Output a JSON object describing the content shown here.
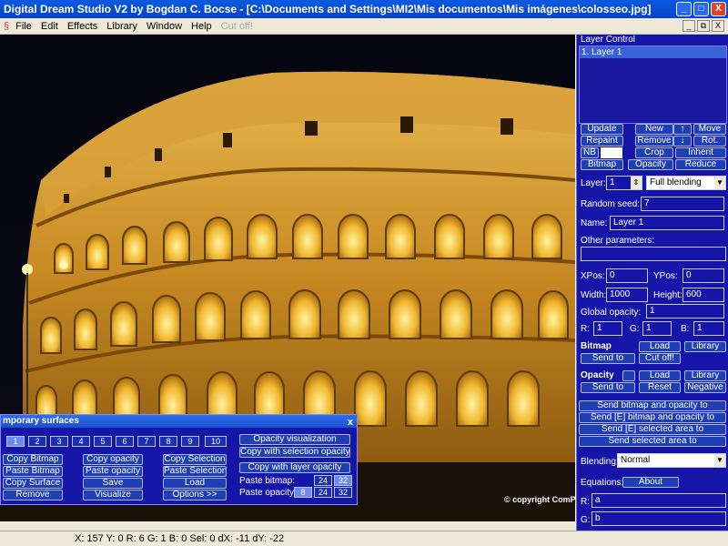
{
  "window": {
    "title": "Digital Dream Studio V2 by Bogdan C. Bocse - [C:\\Documents and Settings\\MI2\\Mis documentos\\Mis imágenes\\colosseo.jpg]",
    "buttons": [
      "_",
      "□",
      "X"
    ]
  },
  "menu": {
    "items": [
      "File",
      "Edit",
      "Effects",
      "Library",
      "Window",
      "Help"
    ],
    "disabled_item": "Cut off!"
  },
  "mdi_buttons": [
    "_",
    "⧉",
    "X"
  ],
  "canvas": {
    "copyright": "© copyright ComP"
  },
  "layer_control": {
    "title": "Layer Control",
    "layers": [
      "1. Layer 1"
    ],
    "buttons": {
      "update": "Update",
      "new": "New",
      "up": "↑",
      "move": "Move",
      "repaint": "Repaint",
      "remove": "Remove",
      "down": "↓",
      "rot": "Rot.",
      "nb": "NB",
      "crop": "Crop",
      "inherit": "Inherit",
      "bitmap": "Bitmap",
      "opacity": "Opacity",
      "reduce": "Reduce"
    },
    "layer_label": "Layer:",
    "layer_value": "1",
    "blend_mode": "Full blending",
    "random_seed_label": "Random seed:",
    "random_seed": "7",
    "name_label": "Name:",
    "name": "Layer 1",
    "other_params_label": "Other parameters:",
    "xpos_label": "XPos:",
    "xpos": "0",
    "ypos_label": "YPos:",
    "ypos": "0",
    "width_label": "Width:",
    "width": "1000",
    "height_label": "Height:",
    "height": "600",
    "global_opacity_label": "Global opacity:",
    "global_opacity": "1",
    "r_label": "R:",
    "r": "1",
    "g_label": "G:",
    "g": "1",
    "b_label": "B:",
    "b": "1",
    "bitmap_section": "Bitmap",
    "bitmap_load": "Load",
    "bitmap_library": "Library",
    "bitmap_sendto": "Send to",
    "bitmap_cutoff": "Cut off!",
    "opacity_section": "Opacity",
    "opacity_load": "Load",
    "opacity_library": "Library",
    "opacity_sendto": "Send to",
    "opacity_reset": "Reset",
    "opacity_negative": "Negative",
    "send_bitmap_opacity": "Send bitmap and opacity to",
    "send_e_bitmap_opacity": "Send [E] bitmap and opacity to",
    "send_e_selected": "Send [E] selected area to",
    "send_selected": "Send selected area to",
    "blending_label": "Blending:",
    "blending_value": "Normal",
    "equations_label": "Equations:",
    "about": "About",
    "eq_r_label": "R:",
    "eq_r": "a",
    "eq_g_label": "G:",
    "eq_g": "b"
  },
  "temp_surfaces": {
    "title": "mporary surfaces",
    "close": "x",
    "numbers": [
      "1",
      "2",
      "3",
      "4",
      "5",
      "6",
      "7",
      "8",
      "9",
      "10"
    ],
    "selected_index": 0,
    "col1": [
      "Copy Bitmap",
      "Paste Bitmap",
      "Copy Surface",
      "Remove"
    ],
    "col2": [
      "Copy opacity",
      "Paste opacity",
      "Save",
      "Visualize"
    ],
    "col3": [
      "Copy Selection",
      "Paste Selection",
      "Load",
      "Options >>"
    ],
    "opacity_visualization": "Opacity visualization",
    "copy_with_selection_opacity": "Copy with selection opacity",
    "copy_with_layer_opacity": "Copy with layer opacity",
    "paste_bitmap_label": "Paste bitmap:",
    "paste_opacity_label": "Paste opacity:",
    "bits": [
      "8",
      "24",
      "32"
    ]
  },
  "status": {
    "text": "X: 157 Y: 0 R: 6 G: 1 B: 0 Sel: 0 dX: -11 dY: -22"
  },
  "colors": {
    "panel_bg": "#1515a8",
    "title_blue": "#0a5ae0",
    "stone_gold": "#d9a530"
  }
}
